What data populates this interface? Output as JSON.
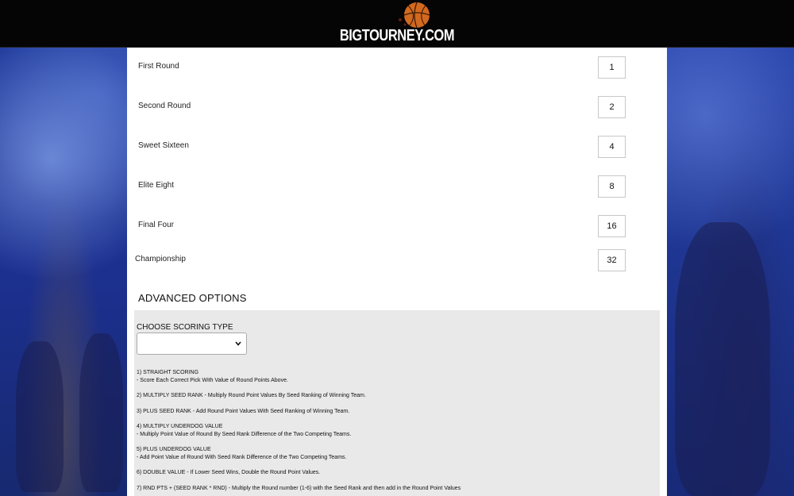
{
  "header": {
    "logo_text": "BIGTOURNEY.COM",
    "logo_icon": "basketball-icon"
  },
  "rounds": [
    {
      "label": "First Round",
      "value": "1"
    },
    {
      "label": "Second Round",
      "value": "2"
    },
    {
      "label": "Sweet Sixteen",
      "value": "4"
    },
    {
      "label": "Elite Eight",
      "value": "8"
    },
    {
      "label": "Final Four",
      "value": "16"
    },
    {
      "label": "Championship",
      "value": "32"
    }
  ],
  "advanced": {
    "title": "ADVANCED OPTIONS",
    "scoring_label": "CHOOSE SCORING TYPE",
    "scoring_selected": "",
    "options": [
      {
        "title": "1) STRAIGHT SCORING",
        "desc": "- Score Each Correct Pick With Value of Round Points Above."
      },
      {
        "title": "2) MULTIPLY SEED RANK - Multiply Round Point Values By Seed Ranking of Winning Team.",
        "desc": ""
      },
      {
        "title": "3) PLUS SEED RANK - Add Round Point Values With Seed Ranking of Winning Team.",
        "desc": ""
      },
      {
        "title": "4) MULTIPLY UNDERDOG VALUE",
        "desc": "- Multiply Point Value of Round By Seed Rank Difference of the Two Competing Teams."
      },
      {
        "title": "5) PLUS UNDERDOG VALUE",
        "desc": "- Add Point Value of Round With Seed Rank Difference of the Two Competing Teams."
      },
      {
        "title": "6) DOUBLE VALUE - If Lower Seed Wins, Double the Round Point Values.",
        "desc": ""
      },
      {
        "title": "7) RND PTS + (SEED RANK * RND) - Multiply the Round number (1-6) with the Seed Rank and then add in the Round Point Values",
        "desc": ""
      }
    ]
  },
  "colors": {
    "header_bg": "#050505",
    "panel_bg": "#ffffff",
    "advanced_bg": "#e9e9e9",
    "background_blue": "#1b2f8a"
  }
}
